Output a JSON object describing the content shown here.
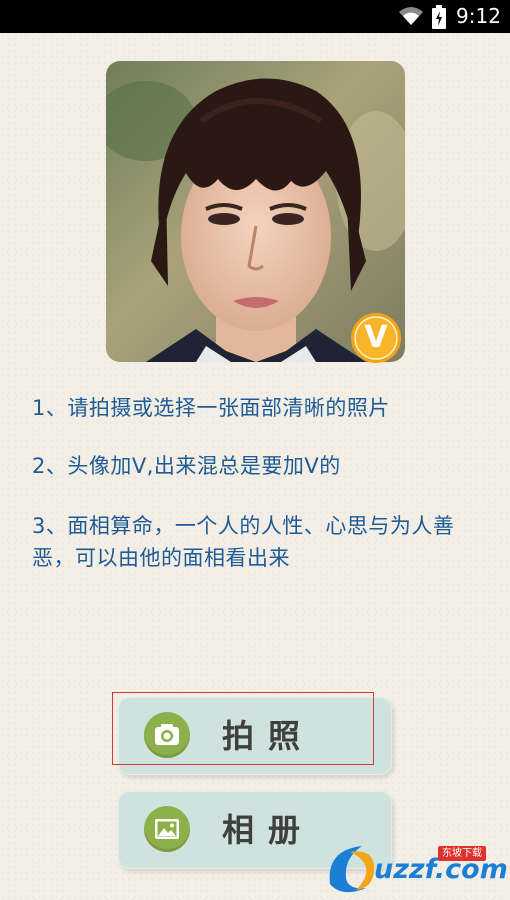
{
  "status_bar": {
    "time": "9:12",
    "icons": [
      "wifi-icon",
      "battery-icon"
    ]
  },
  "avatar": {
    "badge_label": "V",
    "badge_color": "#f2a516"
  },
  "instructions": [
    "1、请拍摄或选择一张面部清晰的照片",
    "2、头像加V,出来混总是要加V的",
    "3、面相算命，一个人的人性、心思与为人善恶，可以由他的面相看出来"
  ],
  "buttons": {
    "camera_label": "拍照",
    "camera_icon": "camera-icon",
    "album_label": "相册",
    "album_icon": "image-icon"
  },
  "colors": {
    "instruction_text": "#1f5b95",
    "button_bg": "#cfe2dd",
    "icon_bg": "#8db04a",
    "selection_border": "#d9363e"
  },
  "watermark": {
    "text": "uzzf.com",
    "tag": "东坡下载"
  }
}
